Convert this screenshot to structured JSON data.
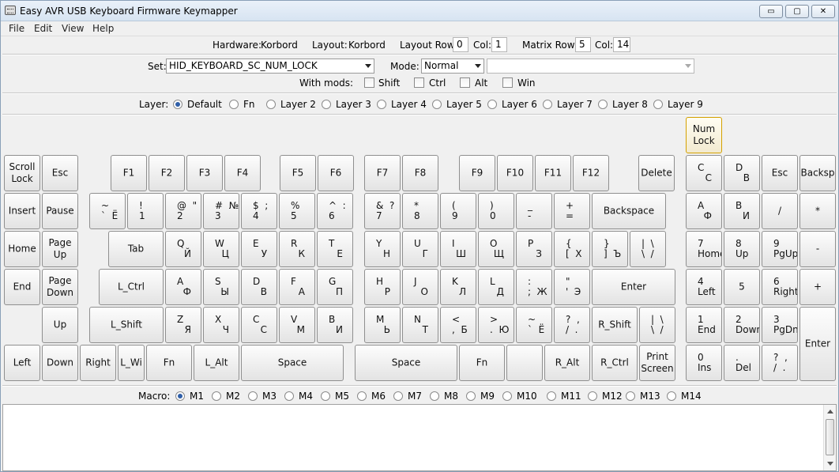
{
  "window": {
    "title": "Easy AVR USB Keyboard Firmware Keymapper",
    "min_icon": "minimize-icon",
    "max_icon": "maximize-icon",
    "close_icon": "close-icon"
  },
  "menu": [
    "File",
    "Edit",
    "View",
    "Help"
  ],
  "info": {
    "hardware_label": "Hardware:",
    "hardware_value": "Korbord",
    "layout_label": "Layout:",
    "layout_value": "Korbord",
    "layout_row_label": "Layout Row:",
    "layout_row_value": "0",
    "col_label": "Col:",
    "col_value": "1",
    "matrix_row_label": "Matrix Row:",
    "matrix_row_value": "5",
    "matrix_col_label": "Col:",
    "matrix_col_value": "14"
  },
  "set": {
    "label": "Set:",
    "value": "HID_KEYBOARD_SC_NUM_LOCK",
    "mode_label": "Mode:",
    "mode_value": "Normal",
    "extra_value": ""
  },
  "mods": {
    "label": "With mods:",
    "items": [
      "Shift",
      "Ctrl",
      "Alt",
      "Win"
    ]
  },
  "layers": {
    "label": "Layer:",
    "items": [
      "Default",
      "Fn",
      "Layer 2",
      "Layer 3",
      "Layer 4",
      "Layer 5",
      "Layer 6",
      "Layer 7",
      "Layer 8",
      "Layer 9"
    ],
    "selected": "Default"
  },
  "keys": [
    {
      "name": "num-lock",
      "c": "Num\nLock",
      "sel": true
    },
    {
      "name": "scroll-lock",
      "c": "Scroll\nLock"
    },
    {
      "name": "esc",
      "c": "Esc"
    },
    {
      "name": "f1",
      "c": "F1"
    },
    {
      "name": "f2",
      "c": "F2"
    },
    {
      "name": "f3",
      "c": "F3"
    },
    {
      "name": "f4",
      "c": "F4"
    },
    {
      "name": "f5",
      "c": "F5"
    },
    {
      "name": "f6",
      "c": "F6"
    },
    {
      "name": "f7",
      "c": "F7"
    },
    {
      "name": "f8",
      "c": "F8"
    },
    {
      "name": "f9",
      "c": "F9"
    },
    {
      "name": "f10",
      "c": "F10"
    },
    {
      "name": "f11",
      "c": "F11"
    },
    {
      "name": "f12",
      "c": "F12"
    },
    {
      "name": "delete",
      "c": "Delete"
    },
    {
      "name": "c",
      "tl": "C",
      "br": "С"
    },
    {
      "name": "d",
      "tl": "D",
      "br": "В"
    },
    {
      "name": "esc-2",
      "c": "Esc"
    },
    {
      "name": "backspace-2",
      "c": "Backsp"
    },
    {
      "name": "insert",
      "c": "Insert"
    },
    {
      "name": "pause",
      "c": "Pause"
    },
    {
      "name": "tilde",
      "tl": "~",
      "bl": "`  Ё"
    },
    {
      "name": "1",
      "tl": "!",
      "bl": "1"
    },
    {
      "name": "2",
      "tl": "@  \"",
      "bl": "2"
    },
    {
      "name": "3",
      "tl": "#  №",
      "bl": "3"
    },
    {
      "name": "4",
      "tl": "$  ;",
      "bl": "4"
    },
    {
      "name": "5",
      "tl": "%",
      "bl": "5"
    },
    {
      "name": "6",
      "tl": "^  :",
      "bl": "6"
    },
    {
      "name": "7",
      "tl": "&  ?",
      "bl": "7"
    },
    {
      "name": "8",
      "tl": "*",
      "bl": "8"
    },
    {
      "name": "9",
      "tl": "(",
      "bl": "9"
    },
    {
      "name": "0",
      "tl": ")",
      "bl": "0"
    },
    {
      "name": "minus",
      "tl": "_",
      "bl": "-"
    },
    {
      "name": "equal",
      "tl": "+",
      "bl": "="
    },
    {
      "name": "backspace",
      "c": "Backspace"
    },
    {
      "name": "a-num",
      "tl": "A",
      "br": "Ф"
    },
    {
      "name": "b-num",
      "tl": "B",
      "br": "И"
    },
    {
      "name": "kp-slash",
      "c": "/"
    },
    {
      "name": "kp-star",
      "c": "*"
    },
    {
      "name": "home",
      "c": "Home"
    },
    {
      "name": "page-up",
      "c": "Page\nUp"
    },
    {
      "name": "tab",
      "c": "Tab"
    },
    {
      "name": "q",
      "tl": "Q",
      "br": "Й"
    },
    {
      "name": "w",
      "tl": "W",
      "br": "Ц"
    },
    {
      "name": "e",
      "tl": "E",
      "br": "У"
    },
    {
      "name": "r",
      "tl": "R",
      "br": "К"
    },
    {
      "name": "t",
      "tl": "T",
      "br": "Е"
    },
    {
      "name": "y",
      "tl": "Y",
      "br": "Н"
    },
    {
      "name": "u",
      "tl": "U",
      "br": "Г"
    },
    {
      "name": "i",
      "tl": "I",
      "br": "Ш"
    },
    {
      "name": "o",
      "tl": "O",
      "br": "Щ"
    },
    {
      "name": "p",
      "tl": "P",
      "br": "З"
    },
    {
      "name": "lbracket",
      "tl": "{",
      "bl": "[  Х"
    },
    {
      "name": "rbracket",
      "tl": "}",
      "bl": "]  Ъ"
    },
    {
      "name": "backslash",
      "tl": "|  \\",
      "bl": "\\  /"
    },
    {
      "name": "kp-7",
      "tl": "7",
      "bl": "Home"
    },
    {
      "name": "kp-8",
      "tl": "8",
      "bl": "Up"
    },
    {
      "name": "kp-9",
      "tl": "9",
      "bl": "PgUp"
    },
    {
      "name": "kp-minus",
      "c": "-"
    },
    {
      "name": "end",
      "c": "End"
    },
    {
      "name": "page-down",
      "c": "Page\nDown"
    },
    {
      "name": "l-ctrl",
      "c": "L_Ctrl"
    },
    {
      "name": "a",
      "tl": "A",
      "br": "Ф"
    },
    {
      "name": "s",
      "tl": "S",
      "br": "Ы"
    },
    {
      "name": "d2",
      "tl": "D",
      "br": "В"
    },
    {
      "name": "f",
      "tl": "F",
      "br": "А"
    },
    {
      "name": "g",
      "tl": "G",
      "br": "П"
    },
    {
      "name": "h",
      "tl": "H",
      "br": "Р"
    },
    {
      "name": "j",
      "tl": "J",
      "br": "О"
    },
    {
      "name": "k",
      "tl": "K",
      "br": "Л"
    },
    {
      "name": "l",
      "tl": "L",
      "br": "Д"
    },
    {
      "name": "semicolon",
      "tl": ":",
      "bl": ";  Ж"
    },
    {
      "name": "quote",
      "tl": "\"",
      "bl": "'  Э"
    },
    {
      "name": "enter",
      "c": "Enter"
    },
    {
      "name": "kp-4",
      "tl": "4",
      "bl": "Left"
    },
    {
      "name": "kp-5",
      "c": "5"
    },
    {
      "name": "kp-6",
      "tl": "6",
      "bl": "Right"
    },
    {
      "name": "kp-plus",
      "c": "+"
    },
    {
      "name": "up",
      "c": "Up"
    },
    {
      "name": "l-shift",
      "c": "L_Shift"
    },
    {
      "name": "z",
      "tl": "Z",
      "br": "Я"
    },
    {
      "name": "x",
      "tl": "X",
      "br": "Ч"
    },
    {
      "name": "c2",
      "tl": "C",
      "br": "С"
    },
    {
      "name": "v",
      "tl": "V",
      "br": "М"
    },
    {
      "name": "b",
      "tl": "B",
      "br": "И"
    },
    {
      "name": "m",
      "tl": "M",
      "br": "Ь"
    },
    {
      "name": "n",
      "tl": "N",
      "br": "Т"
    },
    {
      "name": "comma",
      "tl": "<",
      "bl": ",  Б"
    },
    {
      "name": "period",
      "tl": ">",
      "bl": ".  Ю"
    },
    {
      "name": "grave",
      "tl": "~",
      "bl": "`  Ё"
    },
    {
      "name": "slash",
      "tl": "?  ,",
      "bl": "/  ."
    },
    {
      "name": "r-shift",
      "c": "R_Shift"
    },
    {
      "name": "backslash-2",
      "tl": "|  \\",
      "bl": "\\  /"
    },
    {
      "name": "kp-1",
      "tl": "1",
      "bl": "End"
    },
    {
      "name": "kp-2",
      "tl": "2",
      "bl": "Down"
    },
    {
      "name": "kp-3",
      "tl": "3",
      "bl": "PgDn"
    },
    {
      "name": "kp-enter",
      "c": "Enter"
    },
    {
      "name": "left",
      "c": "Left"
    },
    {
      "name": "down",
      "c": "Down"
    },
    {
      "name": "right",
      "c": "Right"
    },
    {
      "name": "l-win",
      "c": "L_Wi"
    },
    {
      "name": "fn",
      "c": "Fn"
    },
    {
      "name": "l-alt",
      "c": "L_Alt"
    },
    {
      "name": "space-left",
      "c": "Space"
    },
    {
      "name": "space-right",
      "c": "Space"
    },
    {
      "name": "fn-2",
      "c": "Fn"
    },
    {
      "name": "blank",
      "c": ""
    },
    {
      "name": "r-alt",
      "c": "R_Alt"
    },
    {
      "name": "r-ctrl",
      "c": "R_Ctrl"
    },
    {
      "name": "print-screen",
      "c": "Print\nScreen"
    },
    {
      "name": "kp-0",
      "tl": "0",
      "bl": "Ins"
    },
    {
      "name": "kp-dot",
      "tl": ".",
      "bl": "Del"
    },
    {
      "name": "kp-question",
      "tl": "?  ,",
      "bl": "/  ."
    }
  ],
  "macros": {
    "label": "Macro:",
    "items": [
      "M1",
      "M2",
      "M3",
      "M4",
      "M5",
      "M6",
      "M7",
      "M8",
      "M9",
      "M10",
      "M11",
      "M12",
      "M13",
      "M14"
    ],
    "selected": "M1",
    "text": ""
  }
}
